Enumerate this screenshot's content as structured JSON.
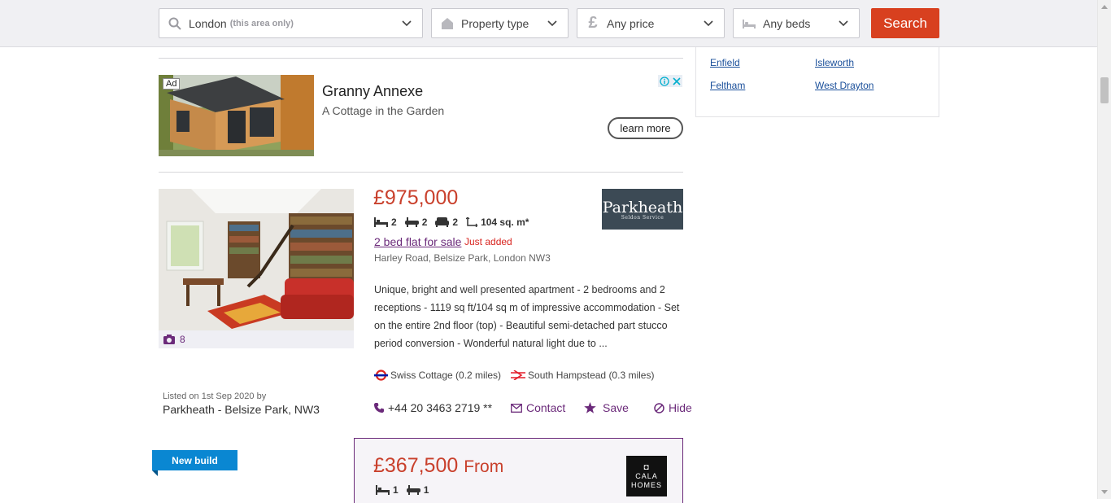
{
  "search_bar": {
    "location_value": "London",
    "location_hint": "(this area only)",
    "property_type_label": "Property type",
    "price_label": "Any price",
    "beds_label": "Any beds",
    "search_button": "Search",
    "accent_color": "#d8401f"
  },
  "side_panel": {
    "links": [
      "Enfield",
      "Isleworth",
      "Feltham",
      "West Drayton"
    ]
  },
  "ad": {
    "badge": "Ad",
    "title": "Granny Annexe",
    "subtitle": "A Cottage in the Garden",
    "cta": "learn more"
  },
  "listings": [
    {
      "price": "£975,000",
      "beds": "2",
      "baths": "2",
      "receptions": "2",
      "size": "104 sq. m*",
      "title": "2 bed flat for sale",
      "badge": "Just added",
      "address": "Harley Road, Belsize Park, London NW3",
      "description": "Unique, bright and well presented apartment - 2 bedrooms and 2 receptions - 1119 sq ft/104 sq m of impressive accommodation - Set on the entire 2nd floor (top) - Beautiful semi-detached part stucco period conversion - Wonderful natural light due to ...",
      "photo_count": "8",
      "stations": [
        {
          "icon": "underground-icon",
          "text": "Swiss Cottage (0.2 miles)"
        },
        {
          "icon": "rail-icon",
          "text": "South Hampstead (0.3 miles)"
        }
      ],
      "listed_on": "Listed on 1st Sep 2020 by",
      "agent": "Parkheath - Belsize Park, NW3",
      "agent_logo_text": "Parkheath",
      "agent_logo_sub": "Seldon Service",
      "phone": "+44 20 3463 2719 **",
      "contact_label": "Contact",
      "save_label": "Save",
      "hide_label": "Hide"
    },
    {
      "label": "New build",
      "price": "£367,500",
      "price_suffix": "From",
      "beds": "1",
      "baths": "1",
      "agent_logo_line1": "CALA",
      "agent_logo_line2": "HOMES"
    }
  ],
  "colors": {
    "price": "#c9402c",
    "link_purple": "#6b2a7a",
    "new_build": "#0a87d2"
  }
}
